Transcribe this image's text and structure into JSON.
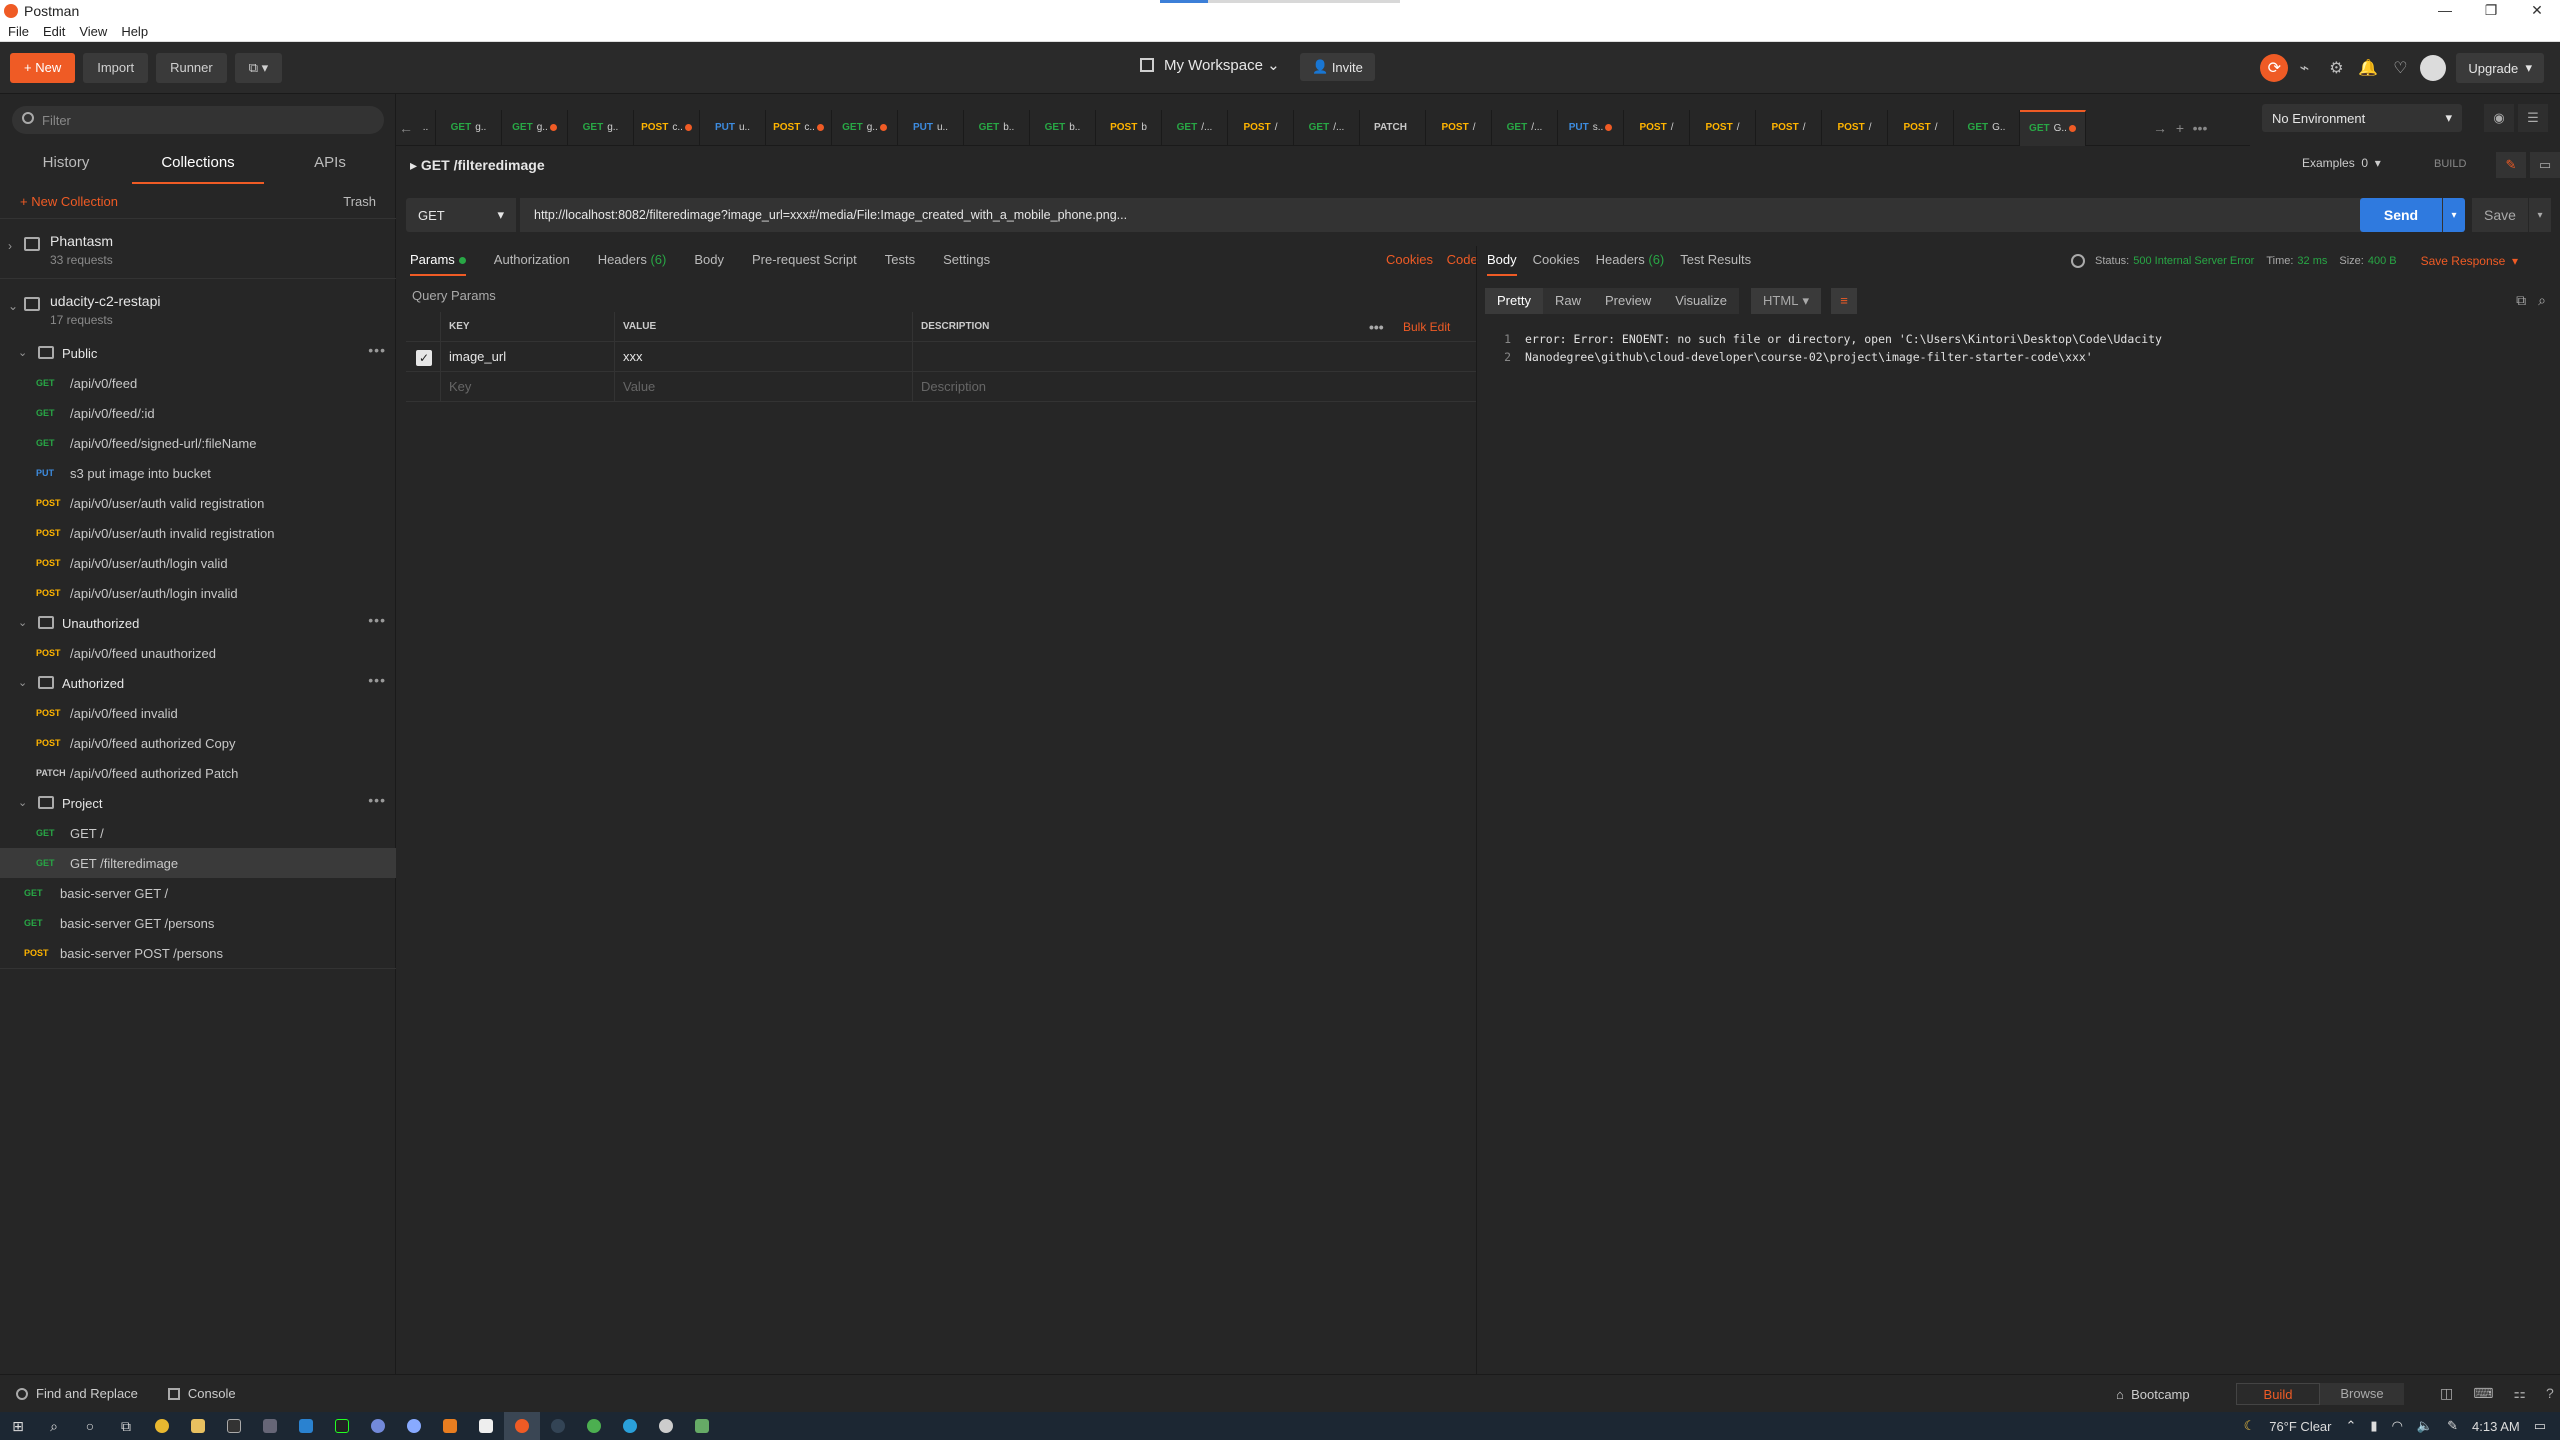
{
  "window": {
    "title": "Postman",
    "controls": [
      "—",
      "❐",
      "✕"
    ]
  },
  "menu": [
    "File",
    "Edit",
    "View",
    "Help"
  ],
  "header": {
    "new_label": "New",
    "import_label": "Import",
    "runner_label": "Runner",
    "workspace_label": "My Workspace",
    "invite_label": "Invite",
    "upgrade_label": "Upgrade"
  },
  "sidebar": {
    "filter_placeholder": "Filter",
    "tabs": [
      "History",
      "Collections",
      "APIs"
    ],
    "new_collection": "New Collection",
    "trash": "Trash",
    "collections": [
      {
        "name": "Phantasm",
        "count": "33 requests"
      },
      {
        "name": "udacity-c2-restapi",
        "count": "17 requests"
      }
    ],
    "folders": {
      "public": "Public",
      "unauthorized": "Unauthorized",
      "authorized": "Authorized",
      "project": "Project"
    },
    "requests": {
      "public": [
        {
          "m": "GET",
          "n": "/api/v0/feed"
        },
        {
          "m": "GET",
          "n": "/api/v0/feed/:id"
        },
        {
          "m": "GET",
          "n": "/api/v0/feed/signed-url/:fileName"
        },
        {
          "m": "PUT",
          "n": "s3 put image into bucket"
        },
        {
          "m": "POST",
          "n": "/api/v0/user/auth valid registration"
        },
        {
          "m": "POST",
          "n": "/api/v0/user/auth invalid registration"
        },
        {
          "m": "POST",
          "n": "/api/v0/user/auth/login valid"
        },
        {
          "m": "POST",
          "n": "/api/v0/user/auth/login invalid"
        }
      ],
      "unauthorized": [
        {
          "m": "POST",
          "n": "/api/v0/feed unauthorized"
        }
      ],
      "authorized": [
        {
          "m": "POST",
          "n": "/api/v0/feed invalid"
        },
        {
          "m": "POST",
          "n": "/api/v0/feed authorized Copy"
        },
        {
          "m": "PATCH",
          "n": "/api/v0/feed authorized Patch"
        }
      ],
      "project": [
        {
          "m": "GET",
          "n": "GET /"
        },
        {
          "m": "GET",
          "n": "GET /filteredimage"
        }
      ],
      "root": [
        {
          "m": "GET",
          "n": "basic-server GET /"
        },
        {
          "m": "GET",
          "n": "basic-server GET /persons"
        },
        {
          "m": "POST",
          "n": "basic-server POST /persons"
        }
      ]
    }
  },
  "tabs": [
    {
      "m": "GET",
      "t": "g..",
      "dot": false
    },
    {
      "m": "GET",
      "t": "g..",
      "dot": true
    },
    {
      "m": "GET",
      "t": "g..",
      "dot": false
    },
    {
      "m": "POST",
      "t": "c..",
      "dot": true
    },
    {
      "m": "PUT",
      "t": "u..",
      "dot": false
    },
    {
      "m": "POST",
      "t": "c..",
      "dot": true
    },
    {
      "m": "GET",
      "t": "g..",
      "dot": true
    },
    {
      "m": "PUT",
      "t": "u..",
      "dot": false
    },
    {
      "m": "GET",
      "t": "b..",
      "dot": false
    },
    {
      "m": "GET",
      "t": "b..",
      "dot": false
    },
    {
      "m": "POST",
      "t": "b",
      "dot": false
    },
    {
      "m": "GET",
      "t": "/...",
      "dot": false
    },
    {
      "m": "POST",
      "t": "/",
      "dot": false
    },
    {
      "m": "GET",
      "t": "/...",
      "dot": false
    },
    {
      "m": "PATCH",
      "t": "",
      "dot": false
    },
    {
      "m": "POST",
      "t": "/",
      "dot": false
    },
    {
      "m": "GET",
      "t": "/...",
      "dot": false
    },
    {
      "m": "PUT",
      "t": "s..",
      "dot": true
    },
    {
      "m": "POST",
      "t": "/",
      "dot": false
    },
    {
      "m": "POST",
      "t": "/",
      "dot": false
    },
    {
      "m": "POST",
      "t": "/",
      "dot": false
    },
    {
      "m": "POST",
      "t": "/",
      "dot": false
    },
    {
      "m": "POST",
      "t": "/",
      "dot": false
    },
    {
      "m": "GET",
      "t": "G..",
      "dot": false
    },
    {
      "m": "GET",
      "t": "G..",
      "dot": true,
      "active": true
    }
  ],
  "environment": "No Environment",
  "request": {
    "title": "GET /filteredimage",
    "examples_label": "Examples",
    "examples_count": "0",
    "build_label": "BUILD",
    "method": "GET",
    "url": "http://localhost:8082/filteredimage?image_url=xxx#/media/File:Image_created_with_a_mobile_phone.png...",
    "send_label": "Send",
    "save_label": "Save",
    "tabs": [
      "Params",
      "Authorization",
      "Headers",
      "Body",
      "Pre-request Script",
      "Tests",
      "Settings"
    ],
    "headers_count": "(6)",
    "cookies_label": "Cookies",
    "code_label": "Code",
    "query_params_label": "Query Params",
    "columns": [
      "KEY",
      "VALUE",
      "DESCRIPTION"
    ],
    "bulk_edit": "Bulk Edit",
    "params": [
      {
        "key": "image_url",
        "value": "xxx"
      }
    ],
    "placeholders": {
      "key": "Key",
      "value": "Value",
      "description": "Description"
    }
  },
  "response": {
    "tabs": [
      "Body",
      "Cookies",
      "Headers",
      "Test Results"
    ],
    "headers_count": "(6)",
    "status_label": "Status:",
    "status_value": "500 Internal Server Error",
    "time_label": "Time:",
    "time_value": "32 ms",
    "size_label": "Size:",
    "size_value": "400 B",
    "save_response": "Save Response",
    "formats": [
      "Pretty",
      "Raw",
      "Preview",
      "Visualize"
    ],
    "format_select": "HTML",
    "lines": [
      "error: Error: ENOENT: no such file or directory, open 'C:\\Users\\Kintori\\Desktop\\Code\\Udacity",
      "Nanodegree\\github\\cloud-developer\\course-02\\project\\image-filter-starter-code\\xxx'"
    ]
  },
  "footer": {
    "find_replace": "Find and Replace",
    "console": "Console",
    "bootcamp": "Bootcamp",
    "build": "Build",
    "browse": "Browse"
  },
  "taskbar": {
    "weather": "76°F  Clear",
    "time": "4:13 AM"
  },
  "colors": {
    "accent": "#ef5b25",
    "send": "#2f7adf",
    "get": "#28a745",
    "post": "#ffb400",
    "put": "#3d8ce0"
  }
}
